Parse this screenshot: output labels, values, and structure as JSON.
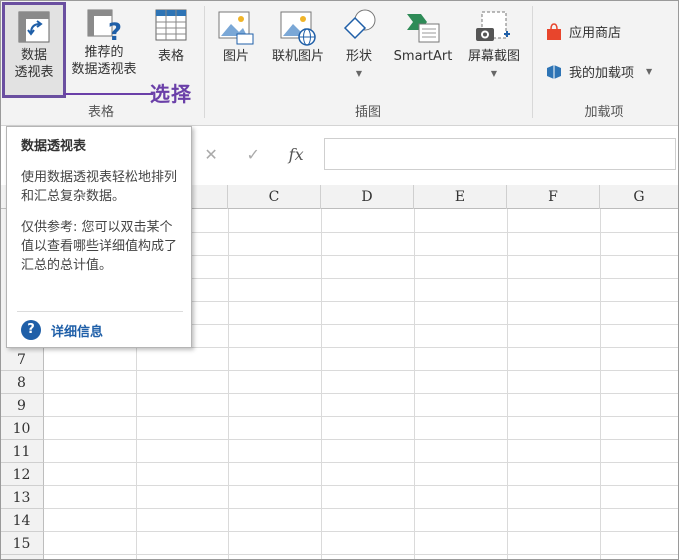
{
  "ribbon": {
    "tables_group": {
      "label": "表格",
      "pivot_table": {
        "line1": "数据",
        "line2": "透视表"
      },
      "recommended_pivot": {
        "line1": "推荐的",
        "line2": "数据透视表"
      },
      "table": {
        "label": "表格"
      }
    },
    "illustrations_group": {
      "label": "插图",
      "picture": "图片",
      "online_picture": "联机图片",
      "shapes": "形状",
      "smartart": "SmartArt",
      "screenshot": "屏幕截图"
    },
    "addins_group": {
      "label": "加载项",
      "store": "应用商店",
      "my_addins": "我的加载项"
    },
    "annotation": "选择"
  },
  "tooltip": {
    "title": "数据透视表",
    "description": "使用数据透视表轻松地排列和汇总复杂数据。",
    "note": "仅供参考: 您可以双击某个值以查看哪些详细值构成了汇总的总计值。",
    "more_info": "详细信息"
  },
  "formula_bar": {
    "cancel": "✕",
    "enter": "✓",
    "fx": "fx",
    "value": ""
  },
  "grid": {
    "columns": [
      "C",
      "D",
      "E",
      "F",
      "G"
    ],
    "rows": [
      "7",
      "8",
      "9",
      "10",
      "11",
      "12",
      "13",
      "14",
      "15"
    ]
  },
  "colors": {
    "highlight": "#6a4fa0",
    "annotation": "#6a3fa8",
    "link": "#1f5fa8",
    "store_icon": "#e8452c",
    "addin_icon": "#2e74b5"
  },
  "icons": [
    "pivot-table-icon",
    "recommended-pivot-icon",
    "table-icon",
    "picture-icon",
    "online-picture-icon",
    "shapes-icon",
    "smartart-icon",
    "screenshot-icon",
    "store-icon",
    "addins-icon",
    "help-icon"
  ]
}
